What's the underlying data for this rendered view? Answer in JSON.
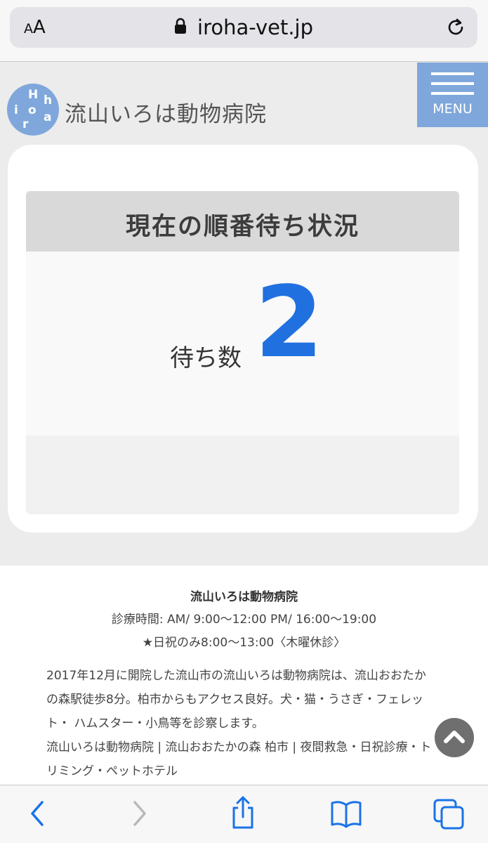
{
  "browser": {
    "text_size_label_small": "A",
    "text_size_label_large": "A",
    "url": "iroha-vet.jp"
  },
  "header": {
    "logo_letters": [
      "H",
      "h",
      "i",
      "o",
      "a",
      "r"
    ],
    "site_name": "流山いろは動物病院",
    "menu_label": "MENU"
  },
  "status": {
    "title": "現在の順番待ち状況",
    "wait_label": "待ち数",
    "wait_count": "2"
  },
  "footer": {
    "clinic_name": "流山いろは動物病院",
    "hours": "診療時間: AM/ 9:00〜12:00  PM/ 16:00〜19:00",
    "holiday": "★日祝のみ8:00〜13:00〈木曜休診〉",
    "description": "2017年12月に開院した流山市の流山いろは動物病院は、流山おおたかの森駅徒歩8分。柏市からもアクセス良好。犬・猫・うさぎ・フェレット・ ハムスター・小鳥等を診察します。",
    "keywords": "流山いろは動物病院 | 流山おおたかの森 柏市 | 夜間救急・日祝診療・トリミング・ペットホテル"
  },
  "colors": {
    "accent_blue": "#7fa7db",
    "number_blue": "#2170e0",
    "ios_blue": "#1a73e8"
  },
  "icons": {
    "lock": "lock-icon",
    "reload": "reload-icon",
    "scroll_top": "chevron-up-icon",
    "back": "back-icon",
    "forward": "forward-icon",
    "share": "share-icon",
    "bookmarks": "bookmarks-icon",
    "tabs": "tabs-icon"
  }
}
